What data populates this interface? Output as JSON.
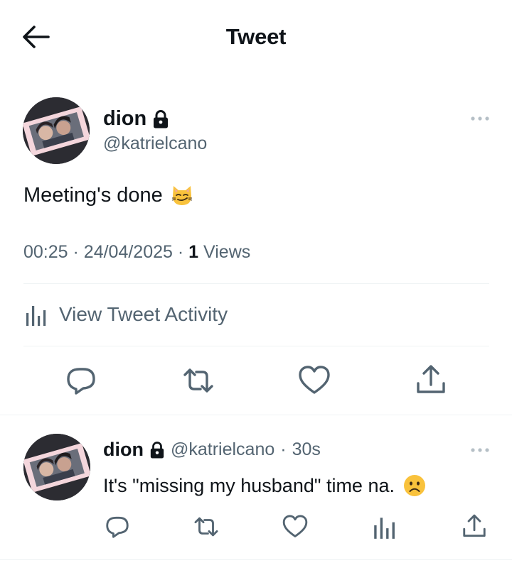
{
  "header": {
    "title": "Tweet",
    "back_icon": "arrow-left-icon"
  },
  "tweet": {
    "author_name": "dion",
    "author_handle": "@katrielcano",
    "locked": true,
    "text": "Meeting's done",
    "emoji": "smirking-cat-emoji",
    "time": "00:25",
    "date": "24/04/2025",
    "views_count": "1",
    "views_label": "Views",
    "separator": "·",
    "activity_label": "View Tweet Activity",
    "actions": [
      "reply-icon",
      "retweet-icon",
      "like-icon",
      "share-icon"
    ]
  },
  "reply": {
    "author_name": "dion",
    "author_handle": "@katrielcano",
    "separator": "·",
    "time_ago": "30s",
    "text": "It's \"missing my husband\" time na.",
    "emoji": "frowning-face-emoji",
    "actions": [
      "reply-icon",
      "retweet-icon",
      "like-icon",
      "views-icon",
      "share-icon"
    ]
  },
  "colors": {
    "text": "#0f1419",
    "secondary": "#536471",
    "divider": "#eff3f4",
    "emoji": "#f9c23c"
  }
}
